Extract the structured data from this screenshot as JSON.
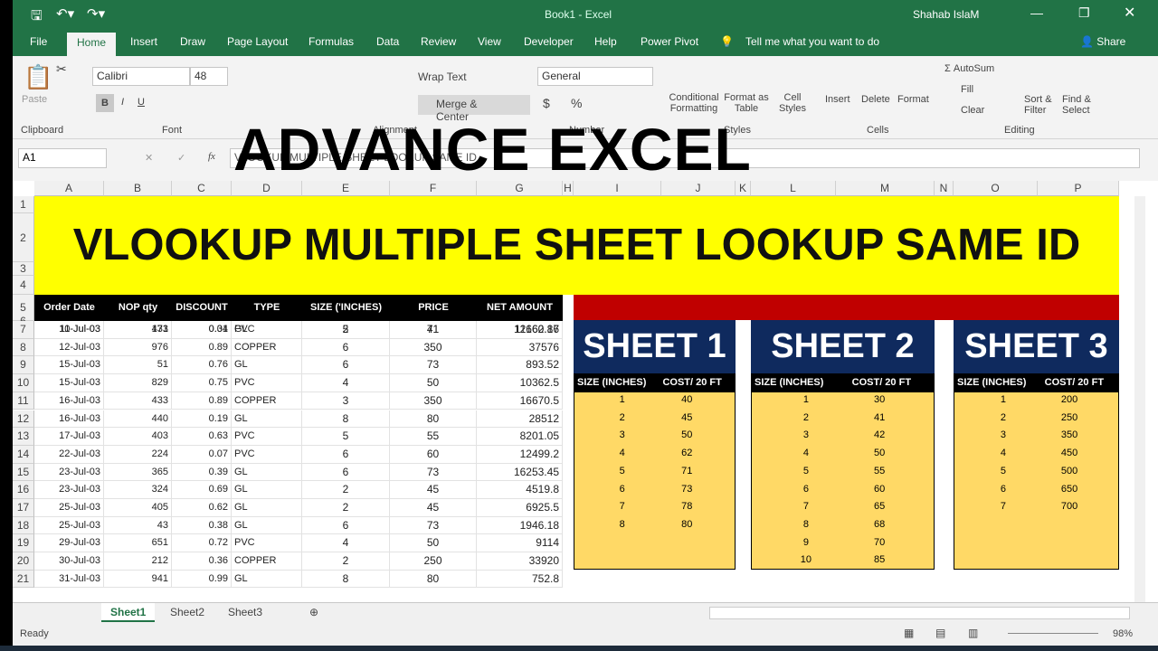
{
  "app": {
    "title": "Book1 - Excel",
    "user": "Shahab IslaM",
    "share": "Share"
  },
  "tabs": [
    "File",
    "Home",
    "Insert",
    "Draw",
    "Page Layout",
    "Formulas",
    "Data",
    "Review",
    "View",
    "Developer",
    "Help",
    "Power Pivot"
  ],
  "tell_me": "Tell me what you want to do",
  "ribbon": {
    "paste": "Paste",
    "clipboard": "Clipboard",
    "font_name": "Calibri",
    "font_size": "48",
    "font": "Font",
    "wrap_text": "Wrap Text",
    "merge_center": "Merge & Center",
    "alignment": "Alignment",
    "number_format": "General",
    "number": "Number",
    "conditional": "Conditional Formatting",
    "format_table": "Format as Table",
    "cell_styles": "Cell Styles",
    "styles": "Styles",
    "insert": "Insert",
    "delete": "Delete",
    "format": "Format",
    "cells": "Cells",
    "autosum": "AutoSum",
    "fill": "Fill",
    "clear": "Clear",
    "sort": "Sort & Filter",
    "find": "Find & Select",
    "editing": "Editing",
    "bold": "B",
    "italic": "I",
    "underline": "U",
    "currency": "$",
    "percent": "%"
  },
  "formula_bar": {
    "name_box": "A1",
    "formula": "VLOOKUP MULTIPLE SHEET LOOKUP SAME ID"
  },
  "overlay_title": "ADVANCE EXCEL",
  "columns": [
    "A",
    "B",
    "C",
    "D",
    "E",
    "F",
    "G",
    "H",
    "I",
    "J",
    "K",
    "L",
    "M",
    "N",
    "O",
    "P"
  ],
  "rows": [
    "1",
    "2",
    "3",
    "4",
    "5",
    "6",
    "7",
    "8",
    "9",
    "10",
    "11",
    "12",
    "13",
    "14",
    "15",
    "16",
    "17",
    "18",
    "19",
    "20",
    "21"
  ],
  "banner": "VLOOKUP MULTIPLE SHEET LOOKUP SAME ID",
  "table": {
    "headers": [
      "Order Date",
      "NOP  qty",
      "DISCOUNT",
      "TYPE",
      "SIZE ('INCHES)",
      "PRICE",
      "NET AMOUNT"
    ],
    "rows": [
      [
        "10-Jul-03",
        "173",
        "0.01",
        "GL",
        "5",
        "71",
        "12160.17"
      ],
      [
        "11-Jul-03",
        "431",
        "0.34",
        "PVC",
        "2",
        "41",
        "11662.86"
      ],
      [
        "12-Jul-03",
        "976",
        "0.89",
        "COPPER",
        "6",
        "350",
        "37576"
      ],
      [
        "15-Jul-03",
        "51",
        "0.76",
        "GL",
        "6",
        "73",
        "893.52"
      ],
      [
        "15-Jul-03",
        "829",
        "0.75",
        "PVC",
        "4",
        "50",
        "10362.5"
      ],
      [
        "16-Jul-03",
        "433",
        "0.89",
        "COPPER",
        "3",
        "350",
        "16670.5"
      ],
      [
        "16-Jul-03",
        "440",
        "0.19",
        "GL",
        "8",
        "80",
        "28512"
      ],
      [
        "17-Jul-03",
        "403",
        "0.63",
        "PVC",
        "5",
        "55",
        "8201.05"
      ],
      [
        "22-Jul-03",
        "224",
        "0.07",
        "PVC",
        "6",
        "60",
        "12499.2"
      ],
      [
        "23-Jul-03",
        "365",
        "0.39",
        "GL",
        "6",
        "73",
        "16253.45"
      ],
      [
        "23-Jul-03",
        "324",
        "0.69",
        "GL",
        "2",
        "45",
        "4519.8"
      ],
      [
        "25-Jul-03",
        "405",
        "0.62",
        "GL",
        "2",
        "45",
        "6925.5"
      ],
      [
        "25-Jul-03",
        "43",
        "0.38",
        "GL",
        "6",
        "73",
        "1946.18"
      ],
      [
        "29-Jul-03",
        "651",
        "0.72",
        "PVC",
        "4",
        "50",
        "9114"
      ],
      [
        "30-Jul-03",
        "212",
        "0.36",
        "COPPER",
        "2",
        "250",
        "33920"
      ],
      [
        "31-Jul-03",
        "941",
        "0.99",
        "GL",
        "8",
        "80",
        "752.8"
      ]
    ]
  },
  "sheets": [
    {
      "title": "SHEET 1",
      "headers": [
        "SIZE (INCHES)",
        "COST/ 20 FT"
      ],
      "rows": [
        [
          "1",
          "40"
        ],
        [
          "2",
          "45"
        ],
        [
          "3",
          "50"
        ],
        [
          "4",
          "62"
        ],
        [
          "5",
          "71"
        ],
        [
          "6",
          "73"
        ],
        [
          "7",
          "78"
        ],
        [
          "8",
          "80"
        ]
      ]
    },
    {
      "title": "SHEET 2",
      "headers": [
        "SIZE (INCHES)",
        "COST/ 20 FT"
      ],
      "rows": [
        [
          "1",
          "30"
        ],
        [
          "2",
          "41"
        ],
        [
          "3",
          "42"
        ],
        [
          "4",
          "50"
        ],
        [
          "5",
          "55"
        ],
        [
          "6",
          "60"
        ],
        [
          "7",
          "65"
        ],
        [
          "8",
          "68"
        ],
        [
          "9",
          "70"
        ],
        [
          "10",
          "85"
        ]
      ]
    },
    {
      "title": "SHEET 3",
      "headers": [
        "SIZE (INCHES)",
        "COST/ 20 FT"
      ],
      "rows": [
        [
          "1",
          "200"
        ],
        [
          "2",
          "250"
        ],
        [
          "3",
          "350"
        ],
        [
          "4",
          "450"
        ],
        [
          "5",
          "500"
        ],
        [
          "6",
          "650"
        ],
        [
          "7",
          "700"
        ]
      ]
    }
  ],
  "sheet_tabs": [
    "Sheet1",
    "Sheet2",
    "Sheet3"
  ],
  "status": {
    "ready": "Ready",
    "zoom": "98%"
  },
  "colors": {
    "excel_green": "#217346",
    "banner": "#ffff00",
    "sheet_title": "#0f2a5e",
    "sheet_body": "#ffd966",
    "red_bar": "#c00000"
  }
}
